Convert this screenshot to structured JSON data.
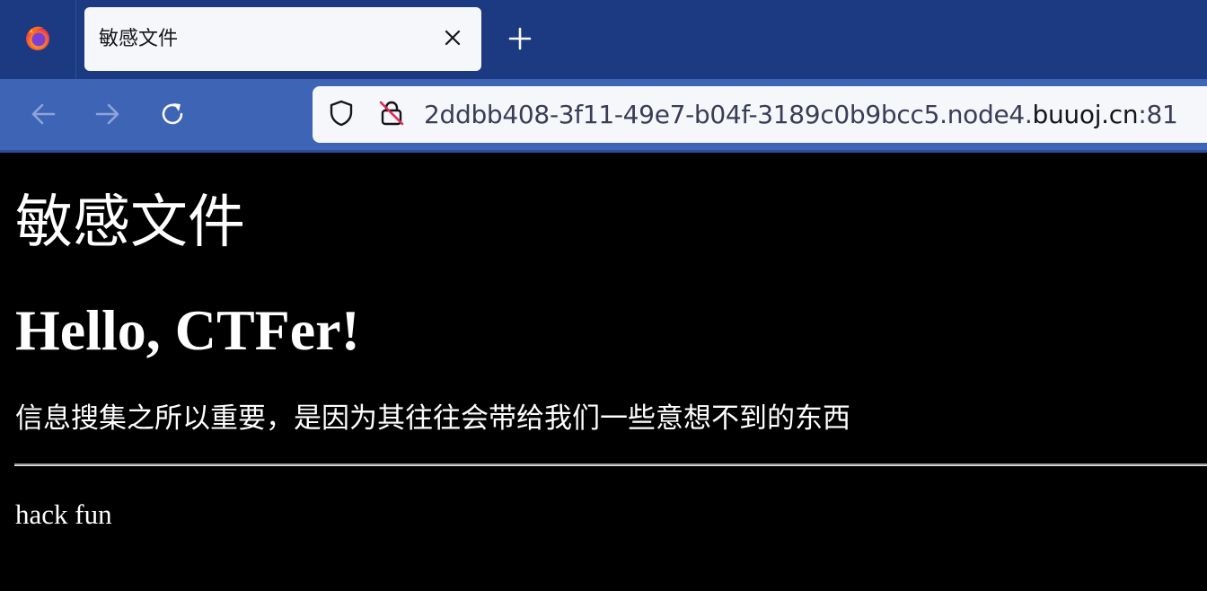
{
  "browser": {
    "tab": {
      "title": "敏感文件"
    },
    "address_bar": {
      "url_prefix": "2ddbb408-3f11-49e7-b04f-3189c0b9bcc5.node4.",
      "url_host": "buuoj.cn",
      "url_port": ":81"
    },
    "icons": {
      "app": "firefox-icon",
      "tab_close": "close-icon",
      "new_tab": "plus-icon",
      "back": "back-arrow-icon",
      "forward": "forward-arrow-icon",
      "reload": "reload-icon",
      "tracking_protection": "shield-icon",
      "insecure_connection": "insecure-lock-icon"
    },
    "colors": {
      "tabbar_bg": "#1b3a82",
      "navbar_bg": "#3d64b5",
      "tab_bg": "#f6f7fb",
      "insecure_strike": "#e22850"
    }
  },
  "page": {
    "heading": "敏感文件",
    "subheading": "Hello, CTFer!",
    "paragraph": "信息搜集之所以重要，是因为其往往会带给我们一些意想不到的东西",
    "footer": "hack fun",
    "background": "#000000",
    "text_color": "#ffffff"
  }
}
